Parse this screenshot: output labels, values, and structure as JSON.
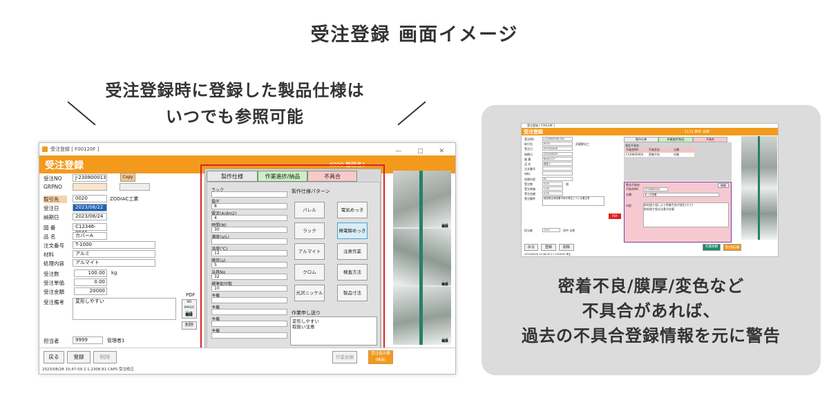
{
  "heading": "受注登録 画面イメージ",
  "caption_left": [
    "受注登録時に登録した製品仕様は",
    "いつでも参照可能"
  ],
  "caption_right": [
    "密着不良/膜厚/変色など",
    "不具合があれば、",
    "過去の不具合登録情報を元に警告"
  ],
  "main": {
    "window_title": "受注登録 [ F00120F ]",
    "header_title": "受注登録",
    "header_user": "0000 管理者1",
    "fields": [
      {
        "label": "受注NO",
        "value": "J-230800013"
      },
      {
        "label": "GRPNO",
        "value": ""
      },
      {
        "label": "取引先",
        "value": "0020",
        "extra": "ZODIAC工業"
      },
      {
        "label": "受注日",
        "value": "2023/08/22"
      },
      {
        "label": "納期日",
        "value": "2023/08/24"
      },
      {
        "label": "図 番",
        "value": "C12346-0041"
      },
      {
        "label": "品 名",
        "value": "カバーA"
      },
      {
        "label": "注文番号",
        "value": "T-1000"
      },
      {
        "label": "材料",
        "value": "アルミ"
      },
      {
        "label": "処理内容",
        "value": "アルマイト"
      },
      {
        "label": "受注数",
        "value": "100.00",
        "extra": "kg"
      },
      {
        "label": "受注単価",
        "value": "0.00"
      },
      {
        "label": "受注金額",
        "value": "20000"
      },
      {
        "label": "受注備考",
        "value": "変形しやすい"
      }
    ],
    "copy_label": "Copy",
    "pdf_label": "PDF",
    "noimage_label": "NO IMAGE",
    "delete_small": "削除",
    "staff_label": "担当者",
    "staff_code": "9999",
    "staff_name": "管理者1",
    "tabs": [
      "製作仕様",
      "作業進捗/納品",
      "不具合"
    ],
    "spec_fields": [
      {
        "label": "ラック",
        "value": ""
      },
      {
        "label": "電圧",
        "value": "8"
      },
      {
        "label": "電流(A/dm2)",
        "value": "4"
      },
      {
        "label": "時間(M)",
        "value": "30"
      },
      {
        "label": "濃度(g/L)",
        "value": ""
      },
      {
        "label": "温度(℃)",
        "value": "12"
      },
      {
        "label": "膜厚(μ)",
        "value": "5"
      },
      {
        "label": "治具No",
        "value": "32"
      },
      {
        "label": "標準取付数",
        "value": "10"
      },
      {
        "label": "予備",
        "value": ""
      },
      {
        "label": "予備",
        "value": ""
      },
      {
        "label": "予備",
        "value": ""
      },
      {
        "label": "予備",
        "value": ""
      }
    ],
    "pattern_title": "製作仕様パターン",
    "patterns": [
      "バレル",
      "電気めっき",
      "ラック",
      "無電解めっき",
      "アルマイト",
      "注意作業",
      "クロム",
      "検査方法",
      "光沢ニッケル",
      "製品寸法"
    ],
    "work_note_label": "作業申し送り",
    "work_note": [
      "変形しやすい",
      "取扱い注意"
    ],
    "back_btn": "戻る",
    "register_btn": "登録",
    "delete_btn": "削除",
    "work_request_btn": "作業依頼",
    "print_btn": "受注指示書\n(納品)",
    "status": "2023/08/28 15:47:09 2.1.2308.81    CAPS 受注修正"
  },
  "mini": {
    "title": "受注登録 [ F00120F ]",
    "header_title": "受注登録",
    "header_user": "1111 田中 太郎",
    "fields": [
      {
        "label": "受注NO",
        "value": "J-230800006-001"
      },
      {
        "label": "取引先",
        "value": "0070",
        "extra": "武蔵野化工"
      },
      {
        "label": "受注日",
        "value": "2023/08/26"
      },
      {
        "label": "納期日",
        "value": "2023/08/29"
      },
      {
        "label": "図 番",
        "value": "Bolt0113"
      },
      {
        "label": "品 名",
        "value": "部品１"
      },
      {
        "label": "注文番号",
        "value": ""
      },
      {
        "label": "材料",
        "value": ""
      },
      {
        "label": "処理内容",
        "value": "Ni"
      },
      {
        "label": "受注数",
        "value": "5.00",
        "extra": "個"
      },
      {
        "label": "受注単価",
        "value": "1.00"
      },
      {
        "label": "受注金額",
        "value": "5.00"
      },
      {
        "label": "受注備考",
        "value": "前回受注時密着不良が発生している要注意"
      }
    ],
    "tabs": [
      "製作仕様",
      "作業進捗/納品",
      "不具合"
    ],
    "defect_section": "発生不具合",
    "defect_cols": [
      "不具合NO",
      "不具合名",
      "分類"
    ],
    "defect_row": [
      "F230800004",
      "密着不良",
      "外観"
    ],
    "warn_title": "警告不具合",
    "warn_no_label": "不具合NO",
    "warn_no": "F230800004",
    "warn_cat_label": "分類",
    "warn_cat": "めっき密着",
    "warn_content_label": "内容",
    "warn_content": [
      "前処理工程により密着不良が発生(カク)",
      "前処理工程は注意が必要"
    ],
    "close_btn": "閉閉",
    "staff_label": "担当者",
    "staff_code": "1111",
    "staff_name": "田中 太郎",
    "back_btn": "戻る",
    "register_btn": "登録",
    "delete_btn": "削除",
    "work_btn": "作業依頼",
    "print_btn": "受注指示書",
    "pdf": "PDF",
    "status": "2023/08/28 15:38:09 2.1.2308.81 修正"
  },
  "colors": {
    "orange": "#f39a1c",
    "red_frame": "#e02020",
    "purple_frame": "#7a3aa8",
    "card_bg": "#dcdcdc"
  }
}
